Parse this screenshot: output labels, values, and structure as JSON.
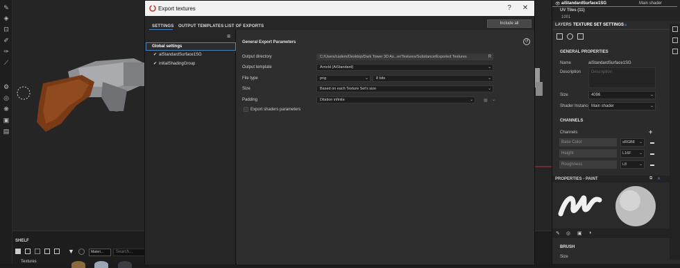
{
  "dialog": {
    "title": "Export textures",
    "tabs": [
      "SETTINGS",
      "OUTPUT TEMPLATES",
      "LIST OF EXPORTS"
    ],
    "include_all": "Include all",
    "tree": {
      "global": "Global settings",
      "items": [
        "aiStandardSurface1SG",
        "initialShadingGroup"
      ]
    },
    "section_title": "General Export Parameters",
    "fields": {
      "output_directory_label": "Output directory",
      "output_directory": "C:/Users/cadem/Desktop/Dark Tower 3D As...er/Textures/Substance/Exported Textures",
      "output_directory_btn": "R",
      "output_template_label": "Output template",
      "output_template": "Arnold (AiStandard)",
      "file_type_label": "File type",
      "file_type": "png",
      "bit_depth": "8 bits",
      "size_label": "Size",
      "size": "Based on each Texture Set's size",
      "padding_label": "Padding",
      "padding": "Dilation infinite",
      "export_shaders": "Export shaders parameters"
    }
  },
  "right_panel": {
    "top_name": "aiStandardSurface1SG",
    "top_shader": "Main shader",
    "uv_tiles": "UV Tiles (11)",
    "uv_tile_peek": "1001",
    "tabs": [
      "LAYERS",
      "TEXTURE SET SETTINGS"
    ],
    "general_properties": "GENERAL PROPERTIES",
    "name_label": "Name",
    "name_value": "aiStandardSurface1SG",
    "description_label": "Description",
    "description_placeholder": "Description",
    "size_label": "Size",
    "size_value": "4096",
    "shader_instance_label": "Shader Instance",
    "shader_instance_value": "Main shader",
    "channels_header": "CHANNELS",
    "channels_label": "Channels",
    "channels": [
      {
        "name": "Base Color",
        "format": "sRGB8"
      },
      {
        "name": "Height",
        "format": "L16F"
      },
      {
        "name": "Roughness",
        "format": "L8"
      }
    ],
    "properties_paint": "PROPERTIES - PAINT",
    "brush_header": "BRUSH",
    "brush_size_label": "Size"
  },
  "shelf": {
    "title": "SHELF",
    "textures": "Textures",
    "materials_tab": "Materi...",
    "search_placeholder": "Search..."
  },
  "colors": {
    "accent": "#4a84c2",
    "dialog_bg": "#2e2e2e",
    "titlebar": "#f2f2f2",
    "wood": "#7a3a16"
  }
}
